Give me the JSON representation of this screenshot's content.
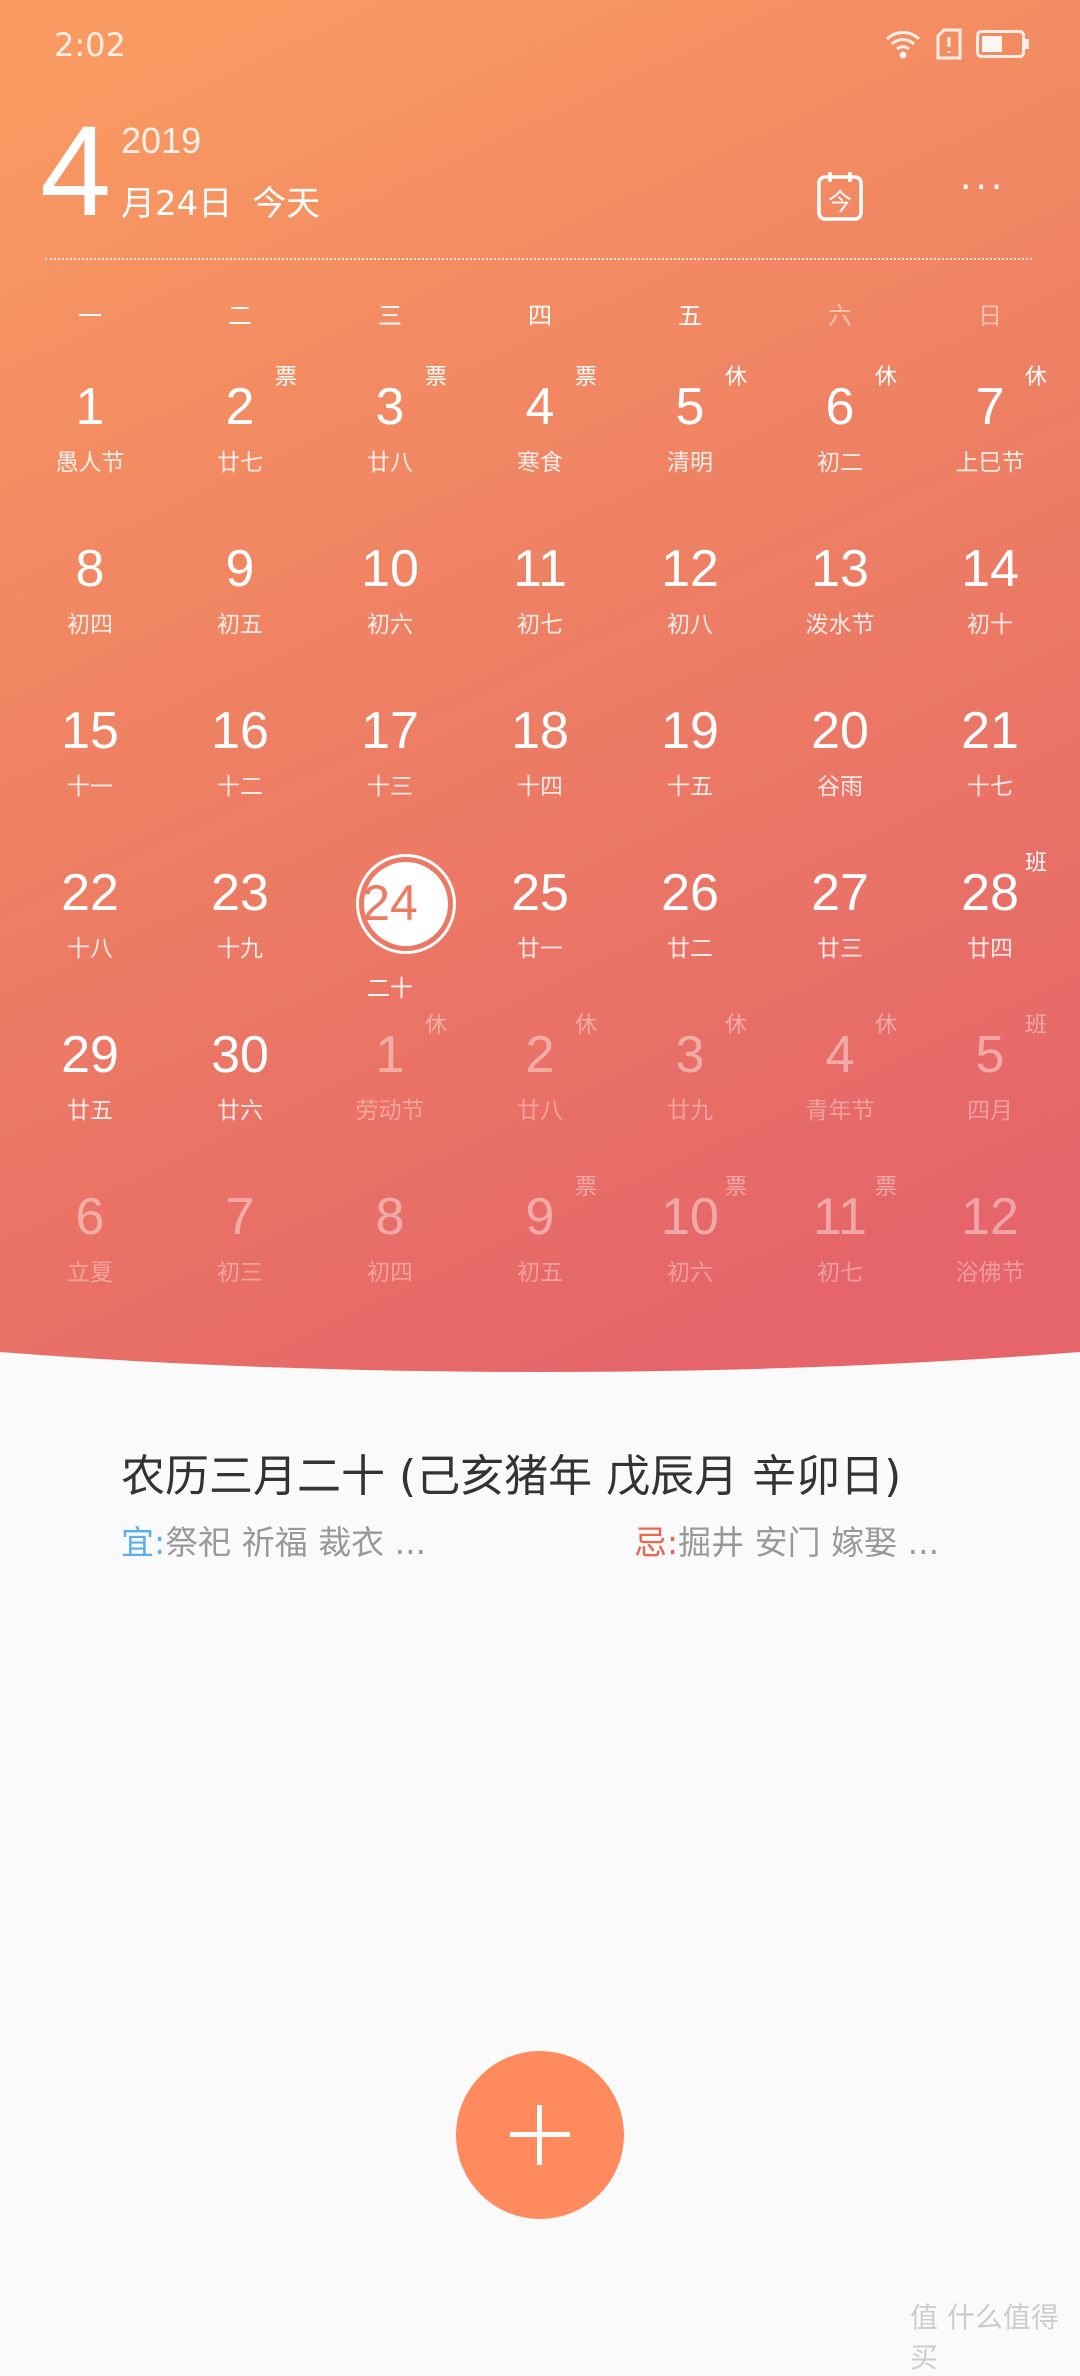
{
  "status_bar": {
    "time": "2:02",
    "icons": [
      "wifi-icon",
      "sim-alert-icon",
      "battery-icon"
    ]
  },
  "header": {
    "month": "4",
    "year": "2019",
    "date": "月24日",
    "today_label": "今天",
    "today_icon_glyph": "今",
    "more": "···"
  },
  "weekdays": [
    "一",
    "二",
    "三",
    "四",
    "五",
    "六",
    "日"
  ],
  "weeks": [
    [
      {
        "d": "1",
        "l": "愚人节"
      },
      {
        "d": "2",
        "l": "廿七",
        "b": "票"
      },
      {
        "d": "3",
        "l": "廿八",
        "b": "票"
      },
      {
        "d": "4",
        "l": "寒食",
        "b": "票"
      },
      {
        "d": "5",
        "l": "清明",
        "b": "休"
      },
      {
        "d": "6",
        "l": "初二",
        "b": "休"
      },
      {
        "d": "7",
        "l": "上巳节",
        "b": "休"
      }
    ],
    [
      {
        "d": "8",
        "l": "初四"
      },
      {
        "d": "9",
        "l": "初五"
      },
      {
        "d": "10",
        "l": "初六"
      },
      {
        "d": "11",
        "l": "初七"
      },
      {
        "d": "12",
        "l": "初八"
      },
      {
        "d": "13",
        "l": "泼水节"
      },
      {
        "d": "14",
        "l": "初十"
      }
    ],
    [
      {
        "d": "15",
        "l": "十一"
      },
      {
        "d": "16",
        "l": "十二"
      },
      {
        "d": "17",
        "l": "十三"
      },
      {
        "d": "18",
        "l": "十四"
      },
      {
        "d": "19",
        "l": "十五"
      },
      {
        "d": "20",
        "l": "谷雨"
      },
      {
        "d": "21",
        "l": "十七"
      }
    ],
    [
      {
        "d": "22",
        "l": "十八"
      },
      {
        "d": "23",
        "l": "十九"
      },
      {
        "d": "24",
        "l": "二十",
        "today": true
      },
      {
        "d": "25",
        "l": "廿一"
      },
      {
        "d": "26",
        "l": "廿二"
      },
      {
        "d": "27",
        "l": "廿三"
      },
      {
        "d": "28",
        "l": "廿四",
        "b": "班"
      }
    ],
    [
      {
        "d": "29",
        "l": "廿五"
      },
      {
        "d": "30",
        "l": "廿六"
      },
      {
        "d": "1",
        "l": "劳动节",
        "b": "休",
        "other": true
      },
      {
        "d": "2",
        "l": "廿八",
        "b": "休",
        "other": true
      },
      {
        "d": "3",
        "l": "廿九",
        "b": "休",
        "other": true
      },
      {
        "d": "4",
        "l": "青年节",
        "b": "休",
        "other": true
      },
      {
        "d": "5",
        "l": "四月",
        "b": "班",
        "other": true
      }
    ],
    [
      {
        "d": "6",
        "l": "立夏",
        "other": true
      },
      {
        "d": "7",
        "l": "初三",
        "other": true
      },
      {
        "d": "8",
        "l": "初四",
        "other": true
      },
      {
        "d": "9",
        "l": "初五",
        "b": "票",
        "other": true
      },
      {
        "d": "10",
        "l": "初六",
        "b": "票",
        "other": true
      },
      {
        "d": "11",
        "l": "初七",
        "b": "票",
        "other": true
      },
      {
        "d": "12",
        "l": "浴佛节",
        "other": true
      }
    ]
  ],
  "details": {
    "lunar": "农历三月二十 (己亥猪年 戊辰月 辛卯日)",
    "yi_label": "宜:",
    "yi": "祭祀 祈福 裁衣 ...",
    "ji_label": "忌:",
    "ji": "掘井 安门 嫁娶 ..."
  },
  "fab": {
    "icon": "plus-icon"
  },
  "watermark": "值 什么值得买",
  "colors": {
    "accent": "#fe8a5e",
    "gradient_start": "#f99a62",
    "gradient_end": "#e5656a",
    "yi": "#5aaef0",
    "ji": "#e8674f"
  }
}
